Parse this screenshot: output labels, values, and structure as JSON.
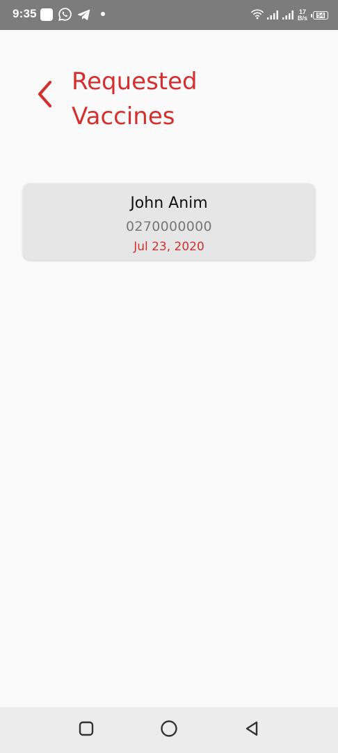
{
  "status_bar": {
    "time": "9:35",
    "net_speed_value": "17",
    "net_speed_unit": "B/s",
    "battery_percent": "54"
  },
  "header": {
    "title": "Requested\nVaccines"
  },
  "requests": [
    {
      "name": "John Anim",
      "phone": "0270000000",
      "date": "Jul 23, 2020"
    }
  ],
  "colors": {
    "accent": "#d32f2f",
    "status_bar": "#7c7c7c",
    "card_bg": "#e6e6e6",
    "nav_bar": "#ececec"
  },
  "icons": {
    "back": "chevron-left-icon",
    "whatsapp": "whatsapp-icon",
    "telegram": "telegram-icon",
    "wifi": "wifi-icon",
    "signal": "signal-icon",
    "battery": "battery-icon",
    "nav_recent": "square-icon",
    "nav_home": "circle-icon",
    "nav_back": "triangle-back-icon"
  }
}
